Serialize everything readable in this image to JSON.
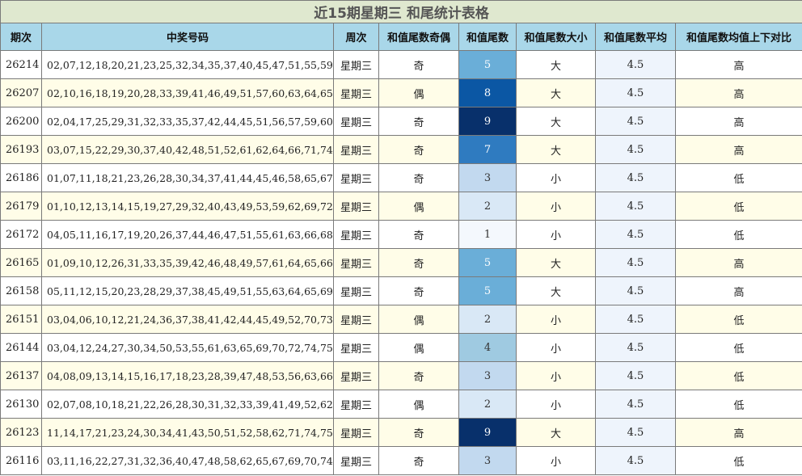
{
  "title": "近15期星期三 和尾统计表格",
  "headers": {
    "issue": "期次",
    "numbers": "中奖号码",
    "weekday": "周次",
    "odd_even": "和值尾数奇偶",
    "tail_sum": "和值尾数",
    "big_small": "和值尾数大小",
    "average": "和值尾数平均",
    "compare": "和值尾数均值上下对比"
  },
  "colors": {
    "title_bg": "#dfe8cf",
    "header_bg": "#a9d7e9",
    "row_even_bg": "#fffde8",
    "sum_scale": {
      "1": "#f4f8fd",
      "2": "#d9e8f6",
      "3": "#c2d9ef",
      "4": "#9fcae1",
      "5": "#6aaed8",
      "7": "#2f7bc0",
      "8": "#0b57a4",
      "9": "#08306b"
    }
  },
  "rows": [
    {
      "issue": "26214",
      "numbers": "02,07,12,18,20,21,23,25,32,34,35,37,40,45,47,51,55,59,61,71",
      "weekday": "星期三",
      "odd_even": "奇",
      "tail_sum": "5",
      "big_small": "大",
      "average": "4.5",
      "compare": "高"
    },
    {
      "issue": "26207",
      "numbers": "02,10,16,18,19,20,28,33,39,41,46,49,51,57,60,63,64,65,71,76",
      "weekday": "星期三",
      "odd_even": "偶",
      "tail_sum": "8",
      "big_small": "大",
      "average": "4.5",
      "compare": "高"
    },
    {
      "issue": "26200",
      "numbers": "02,04,17,25,29,31,32,33,35,37,42,44,45,51,56,57,59,60,64,66",
      "weekday": "星期三",
      "odd_even": "奇",
      "tail_sum": "9",
      "big_small": "大",
      "average": "4.5",
      "compare": "高"
    },
    {
      "issue": "26193",
      "numbers": "03,07,15,22,29,30,37,40,42,48,51,52,61,62,64,66,71,74,75,78",
      "weekday": "星期三",
      "odd_even": "奇",
      "tail_sum": "7",
      "big_small": "大",
      "average": "4.5",
      "compare": "高"
    },
    {
      "issue": "26186",
      "numbers": "01,07,11,18,21,23,26,28,30,34,37,41,44,45,46,58,65,67,71,80",
      "weekday": "星期三",
      "odd_even": "奇",
      "tail_sum": "3",
      "big_small": "小",
      "average": "4.5",
      "compare": "低"
    },
    {
      "issue": "26179",
      "numbers": "01,10,12,13,14,15,19,27,29,32,40,43,49,53,59,62,69,72,73,80",
      "weekday": "星期三",
      "odd_even": "偶",
      "tail_sum": "2",
      "big_small": "小",
      "average": "4.5",
      "compare": "低"
    },
    {
      "issue": "26172",
      "numbers": "04,05,11,16,17,19,20,26,37,44,46,47,51,55,61,63,66,68,70,75",
      "weekday": "星期三",
      "odd_even": "奇",
      "tail_sum": "1",
      "big_small": "小",
      "average": "4.5",
      "compare": "低"
    },
    {
      "issue": "26165",
      "numbers": "01,09,10,12,26,31,33,35,39,42,46,48,49,57,61,64,65,66,67,74",
      "weekday": "星期三",
      "odd_even": "奇",
      "tail_sum": "5",
      "big_small": "大",
      "average": "4.5",
      "compare": "高"
    },
    {
      "issue": "26158",
      "numbers": "05,11,12,15,20,23,28,29,37,38,45,49,51,55,63,64,65,69,77,79",
      "weekday": "星期三",
      "odd_even": "奇",
      "tail_sum": "5",
      "big_small": "大",
      "average": "4.5",
      "compare": "高"
    },
    {
      "issue": "26151",
      "numbers": "03,04,06,10,12,21,24,36,37,38,41,42,44,45,49,52,70,73,77,78",
      "weekday": "星期三",
      "odd_even": "偶",
      "tail_sum": "2",
      "big_small": "小",
      "average": "4.5",
      "compare": "低"
    },
    {
      "issue": "26144",
      "numbers": "03,04,12,24,27,30,34,50,53,55,61,63,65,69,70,72,74,75,76,77",
      "weekday": "星期三",
      "odd_even": "偶",
      "tail_sum": "4",
      "big_small": "小",
      "average": "4.5",
      "compare": "低"
    },
    {
      "issue": "26137",
      "numbers": "04,08,09,13,14,15,16,17,18,23,28,39,47,48,53,56,63,66,77,79",
      "weekday": "星期三",
      "odd_even": "奇",
      "tail_sum": "3",
      "big_small": "小",
      "average": "4.5",
      "compare": "低"
    },
    {
      "issue": "26130",
      "numbers": "02,07,08,10,18,21,22,26,28,30,31,32,33,39,41,49,52,62,64,67",
      "weekday": "星期三",
      "odd_even": "偶",
      "tail_sum": "2",
      "big_small": "小",
      "average": "4.5",
      "compare": "低"
    },
    {
      "issue": "26123",
      "numbers": "11,14,17,21,23,24,30,34,41,43,50,51,52,58,62,71,74,75,78,80",
      "weekday": "星期三",
      "odd_even": "奇",
      "tail_sum": "9",
      "big_small": "大",
      "average": "4.5",
      "compare": "高"
    },
    {
      "issue": "26116",
      "numbers": "03,11,16,22,27,31,32,36,40,47,48,58,62,65,67,69,70,74,75,80",
      "weekday": "星期三",
      "odd_even": "奇",
      "tail_sum": "3",
      "big_small": "小",
      "average": "4.5",
      "compare": "低"
    }
  ]
}
